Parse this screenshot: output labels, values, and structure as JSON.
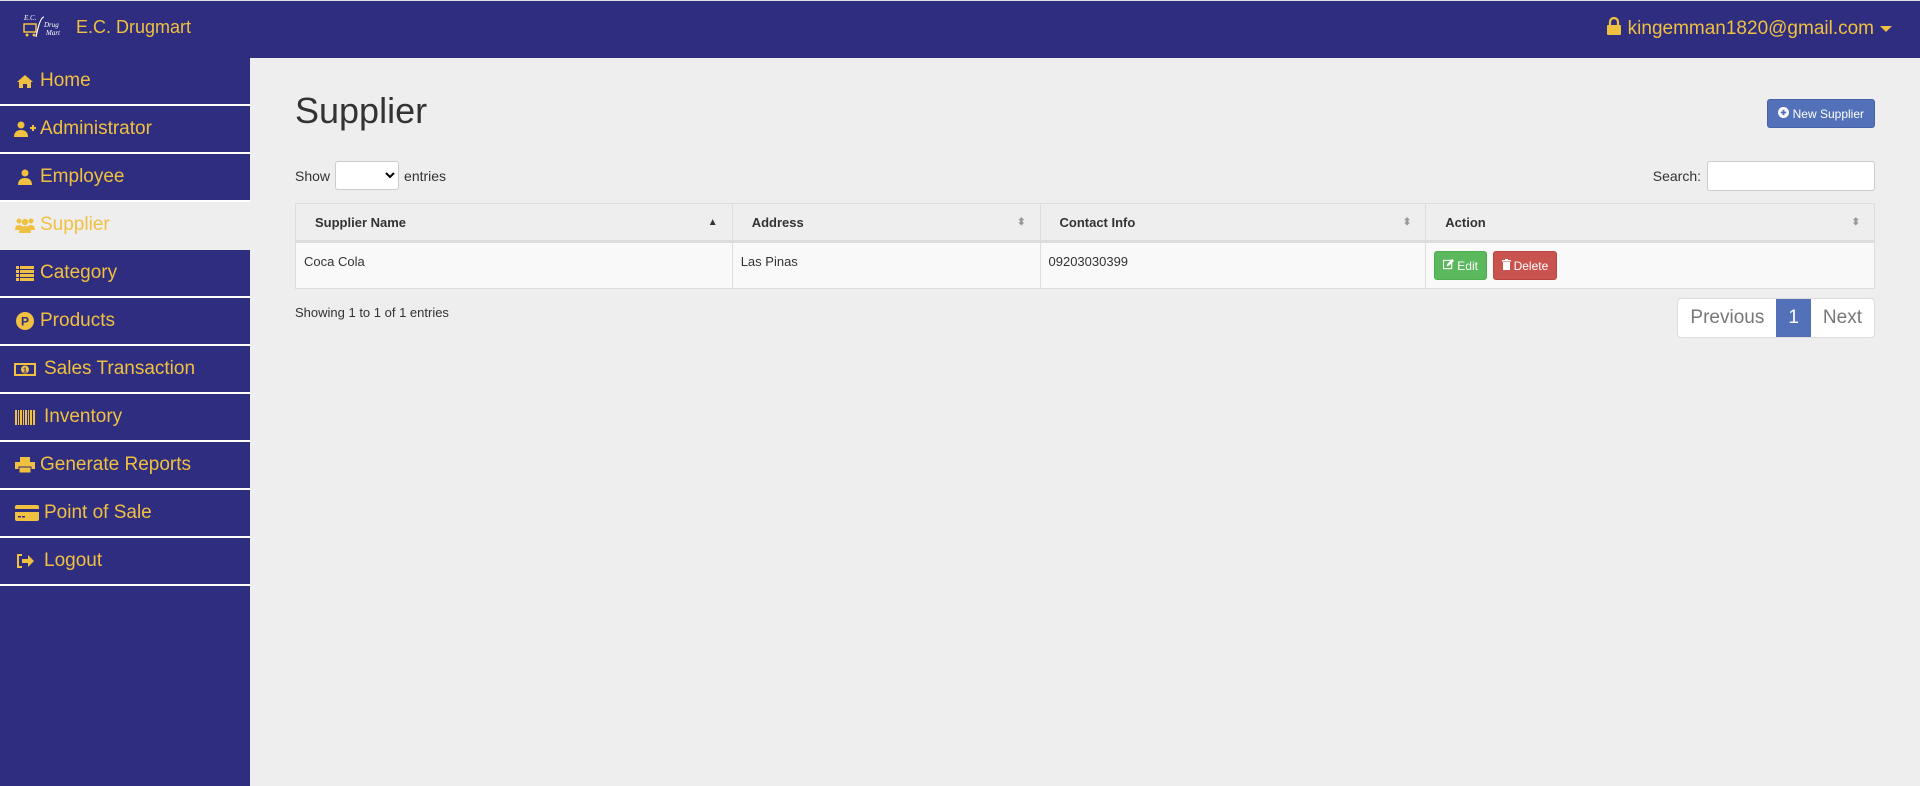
{
  "header": {
    "brand": "E.C. Drugmart",
    "logo_text": [
      "E.C.",
      "Drug",
      "Mart"
    ],
    "user_email": "kingemman1820@gmail.com"
  },
  "sidebar": {
    "items": [
      {
        "label": "Home",
        "icon": "home-icon"
      },
      {
        "label": "Administrator",
        "icon": "user-plus-icon"
      },
      {
        "label": "Employee",
        "icon": "user-icon"
      },
      {
        "label": "Supplier",
        "icon": "users-icon",
        "active": true
      },
      {
        "label": "Category",
        "icon": "list-icon"
      },
      {
        "label": "Products",
        "icon": "product-p-icon"
      },
      {
        "label": "Sales Transaction",
        "icon": "money-icon"
      },
      {
        "label": "Inventory",
        "icon": "barcode-icon"
      },
      {
        "label": "Generate Reports",
        "icon": "print-icon"
      },
      {
        "label": "Point of Sale",
        "icon": "credit-card-icon"
      },
      {
        "label": "Logout",
        "icon": "sign-out-icon"
      }
    ]
  },
  "main": {
    "title": "Supplier",
    "new_button": "New Supplier",
    "show_label": "Show",
    "entries_label": "entries",
    "page_length_value": "",
    "search_label": "Search:",
    "search_value": "",
    "table": {
      "columns": [
        "Supplier Name",
        "Address",
        "Contact Info",
        "Action"
      ],
      "rows": [
        {
          "name": "Coca Cola",
          "address": "Las Pinas",
          "contact": "09203030399"
        }
      ],
      "edit_label": "Edit",
      "delete_label": "Delete"
    },
    "info": "Showing 1 to 1 of 1 entries",
    "pagination": {
      "previous": "Previous",
      "current": "1",
      "next": "Next"
    }
  },
  "colors": {
    "navy": "#2e2d7f",
    "gold": "#f0c040",
    "primary": "#5271b8",
    "success": "#5cb85c",
    "danger": "#c9534f"
  }
}
